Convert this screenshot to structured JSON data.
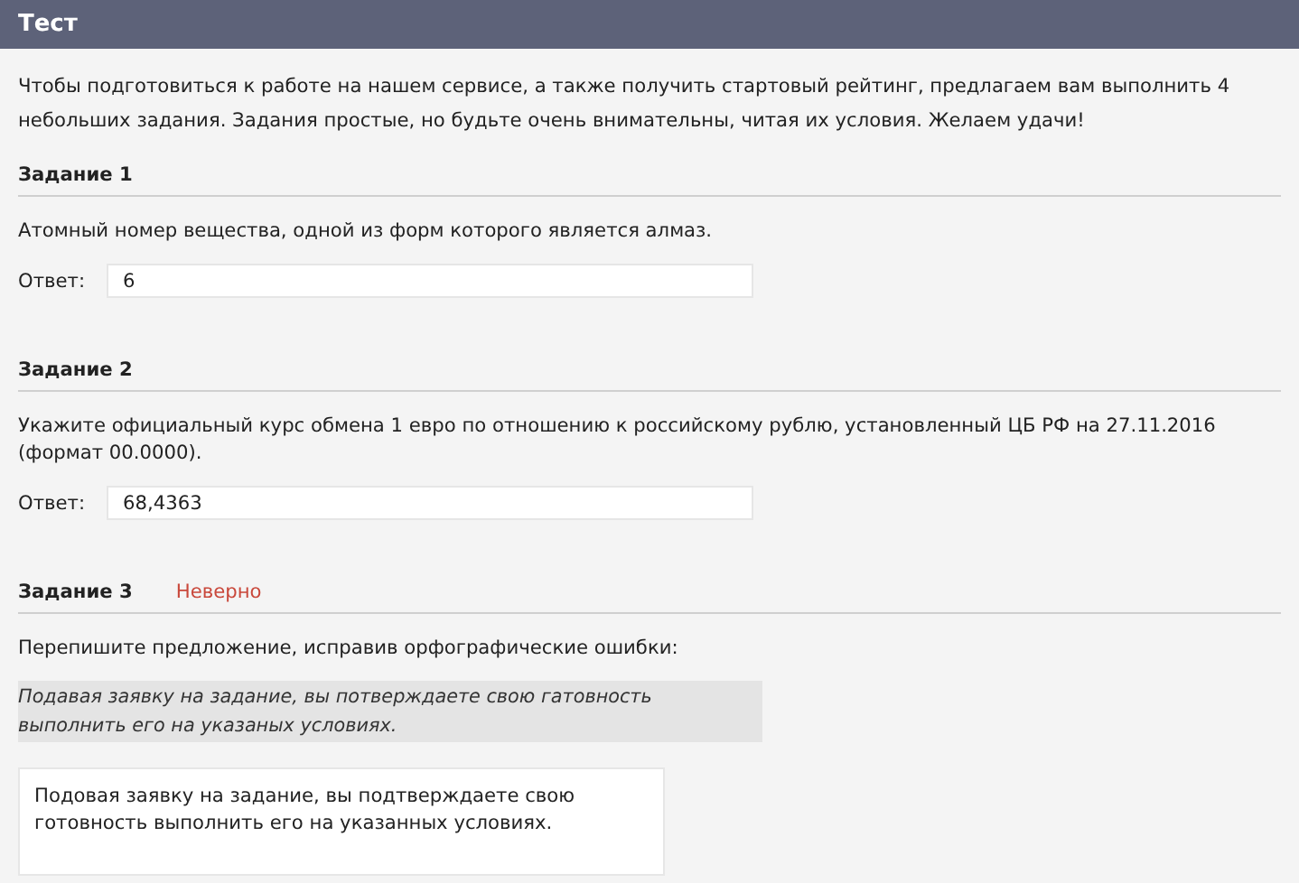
{
  "header": {
    "title": "Тест"
  },
  "intro": "Чтобы подготовиться к работе на нашем сервисе, а также получить стартовый рейтинг, предлагаем вам выполнить 4 небольших задания. Задания простые, но будьте очень внимательны, читая их условия. Желаем удачи!",
  "tasks": [
    {
      "kind": "answer",
      "title": "Задание 1",
      "question": "Атомный номер вещества, одной из форм которого является алмаз.",
      "answer_label": "Ответ:",
      "value": "6"
    },
    {
      "kind": "answer",
      "title": "Задание 2",
      "question": "Укажите официальный курс обмена 1 евро по отношению к российскому рублю, установленный ЦБ РФ на 27.11.2016 (формат 00.0000).",
      "answer_label": "Ответ:",
      "value": "68,4363"
    },
    {
      "kind": "rewrite",
      "title": "Задание 3",
      "status": {
        "kind": "wrong",
        "text": "Неверно"
      },
      "question": "Перепишите предложение, исправив орфографические ошибки:",
      "quote": "Подавая заявку на задание, вы потверждаете свою гатовность выполнить его на указаных условиях.",
      "value": "Подовая заявку на задание, вы подтверждаете свою готовность выполнить его на указанных условиях."
    }
  ]
}
